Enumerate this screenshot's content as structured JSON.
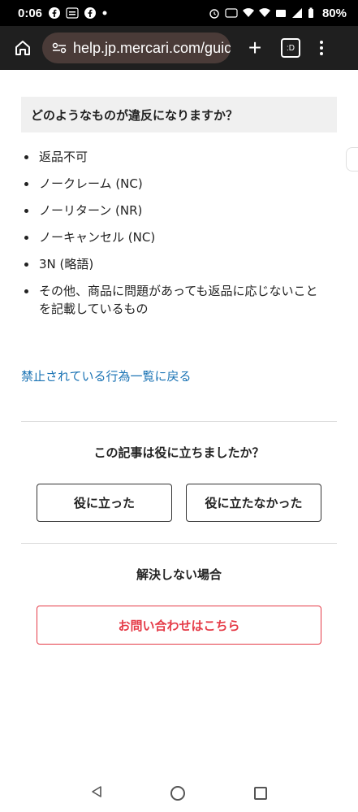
{
  "status_bar": {
    "time": "0:06",
    "battery": "80%",
    "icons": [
      "facebook-icon",
      "temu-icon",
      "facebook-icon",
      "dot-icon",
      "alarm-icon",
      "hd-icon",
      "wifi-icon",
      "wifi-calling-icon",
      "lte-icon",
      "signal-icon",
      "battery-icon"
    ]
  },
  "browser": {
    "url": "help.jp.mercari.com/guic",
    "tabs_label": ":D"
  },
  "article": {
    "question": "どのようなものが違反になりますか？",
    "bullets": [
      "返品不可",
      "ノークレーム (NC)",
      "ノーリターン (NR)",
      "ノーキャンセル (NC)",
      "3N (略語)",
      "その他、商品に問題があっても返品に応じないことを記載しているもの"
    ],
    "back_link": "禁止されている行為一覧に戻る"
  },
  "feedback": {
    "question": "この記事は役に立ちましたか？",
    "yes_label": "役に立った",
    "no_label": "役に立たなかった"
  },
  "support": {
    "heading": "解決しない場合",
    "contact_label": "お問い合わせはこちら"
  },
  "colors": {
    "link": "#1a73b4",
    "contact_accent": "#e53b47",
    "toolbar_bg": "#1f1f1f",
    "urlbar_bg": "#4a3b38"
  }
}
